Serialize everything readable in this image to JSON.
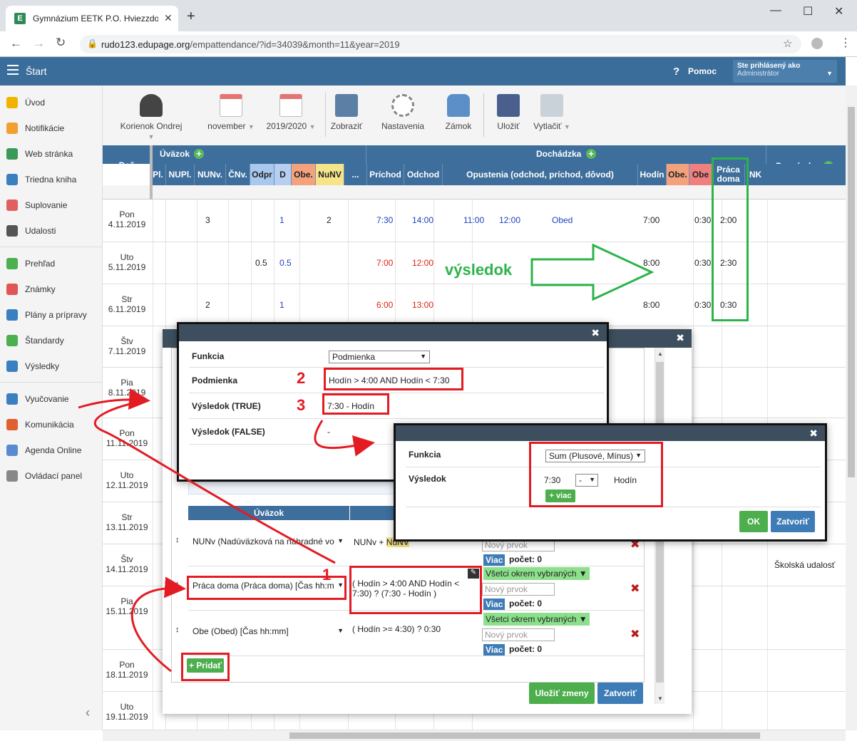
{
  "browser": {
    "tab_title": "Gymnázium EETK P.O. Hviezzdos",
    "url_host": "rudo123.edupage.org",
    "url_path": "/empattendance/?id=34039&month=11&year=2019"
  },
  "app": {
    "start_label": "Štart",
    "help_label": "Pomoc",
    "user_line1": "Ste prihlásený ako",
    "user_line2": "Administrátor"
  },
  "sidebar": [
    "Úvod",
    "Notifikácie",
    "Web stránka",
    "Triedna kniha",
    "Suplovanie",
    "Udalosti",
    "Prehľad",
    "Známky",
    "Plány a prípravy",
    "Štandardy",
    "Výsledky",
    "Vyučovanie",
    "Komunikácia",
    "Agenda Online",
    "Ovládací panel"
  ],
  "toolbar": {
    "person": "Korienok Ondrej",
    "month": "november",
    "year": "2019/2020",
    "show": "Zobraziť",
    "settings": "Nastavenia",
    "lock": "Zámok",
    "save": "Uložiť",
    "print": "Vytlačiť"
  },
  "table": {
    "day_header": "Deň",
    "uvazok_header": "Úväzok",
    "dochadzka_header": "Dochádzka",
    "poznamka_header": "Poznámka",
    "cols": [
      "Pl.",
      "NUPl.",
      "NUNv.",
      "ČNv.",
      "Odpr",
      "D",
      "Obe.",
      "NuNV",
      "...",
      "Príchod",
      "Odchod",
      "Opustenia (odchod, príchod, dôvod)",
      "Hodín",
      "Obe.",
      "Obe",
      "NK"
    ],
    "praca_doma_l1": "Práca",
    "praca_doma_l2": "doma",
    "rows": [
      {
        "day": "Pon",
        "date": "4.11.2019",
        "nunv": "3",
        "d": "1",
        "nunv2": "2",
        "in": "7:30",
        "out": "14:00",
        "l_out": "11:00",
        "l_in": "12:00",
        "reason": "Obed",
        "hours": "7:00",
        "obe": "0:30",
        "home": "2:00"
      },
      {
        "day": "Uto",
        "date": "5.11.2019",
        "odpr": "0.5",
        "d": "0.5",
        "in": "7:00",
        "out": "12:00",
        "hours": "8:00",
        "obe": "0:30",
        "home": "2:30"
      },
      {
        "day": "Str",
        "date": "6.11.2019",
        "nunv": "2",
        "d": "1",
        "in": "6:00",
        "out": "13:00",
        "hours": "8:00",
        "obe": "0:30",
        "home": "0:30"
      },
      {
        "day": "Štv",
        "date": "7.11.2019"
      },
      {
        "day": "Pia",
        "date": "8.11.2019"
      },
      {
        "day": "Pon",
        "date": "11.11.2019"
      },
      {
        "day": "Uto",
        "date": "12.11.2019"
      },
      {
        "day": "Str",
        "date": "13.11.2019"
      },
      {
        "day": "Štv",
        "date": "14.11.2019",
        "note": "Školská udalosť"
      },
      {
        "day": "Pia",
        "date": "15.11.2019"
      },
      {
        "day": "Pon",
        "date": "18.11.2019"
      },
      {
        "day": "Uto",
        "date": "19.11.2019"
      }
    ]
  },
  "annotation": {
    "vysledok": "výsledok"
  },
  "main_dialog": {
    "uvazok_col": "Úväzok",
    "rows": [
      {
        "name": "NUNv (Nadúväzková na náhradné vo",
        "formula_a": "NUNv +",
        "formula_b": "NuNV",
        "inp": "Nový prvok",
        "viac": "Viac",
        "count": "počet: 0"
      },
      {
        "name": "Práca doma (Práca doma) [Čas hh:m",
        "formula": "( Hodín > 4:00 AND Hodín < 7:30) ? (7:30 - Hodín )",
        "green": "Všetci okrem vybraných",
        "inp": "Nový prvok",
        "viac": "Viac",
        "count": "počet: 0"
      },
      {
        "name": "Obe (Obed) [Čas hh:mm]",
        "formula": "( Hodín >= 4:30) ? 0:30",
        "green": "Všetci okrem vybraných",
        "inp": "Nový prvok",
        "viac": "Viac",
        "count": "počet: 0"
      }
    ],
    "add_btn": "+ Pridať",
    "save_btn": "Uložiť zmeny",
    "close_btn": "Zatvoriť"
  },
  "cond_dialog": {
    "l_func": "Funkcia",
    "func_value": "Podmienka",
    "l_cond": "Podmienka",
    "cond_value": "Hodín > 4:00 AND Hodín < 7:30",
    "l_true": "Výsledok (TRUE)",
    "true_value": "7:30 - Hodín",
    "l_false": "Výsledok (FALSE)",
    "false_value": "-"
  },
  "sum_dialog": {
    "l_func": "Funkcia",
    "func_value": "Sum (Plusové, Mínus)",
    "l_result": "Výsledok",
    "v1": "7:30",
    "op": "-",
    "v2": "Hodín",
    "more_btn": "+ viac",
    "ok_btn": "OK",
    "close_btn": "Zatvoriť"
  },
  "callouts": [
    "1",
    "2",
    "3"
  ],
  "colors": {
    "header_blue": "#3d6e9c",
    "app_blue": "#3a6d9a",
    "annot_red": "#e31b23",
    "annot_green": "#2db34a",
    "btn_green": "#4cae4c",
    "btn_blue": "#3d7cb6"
  }
}
